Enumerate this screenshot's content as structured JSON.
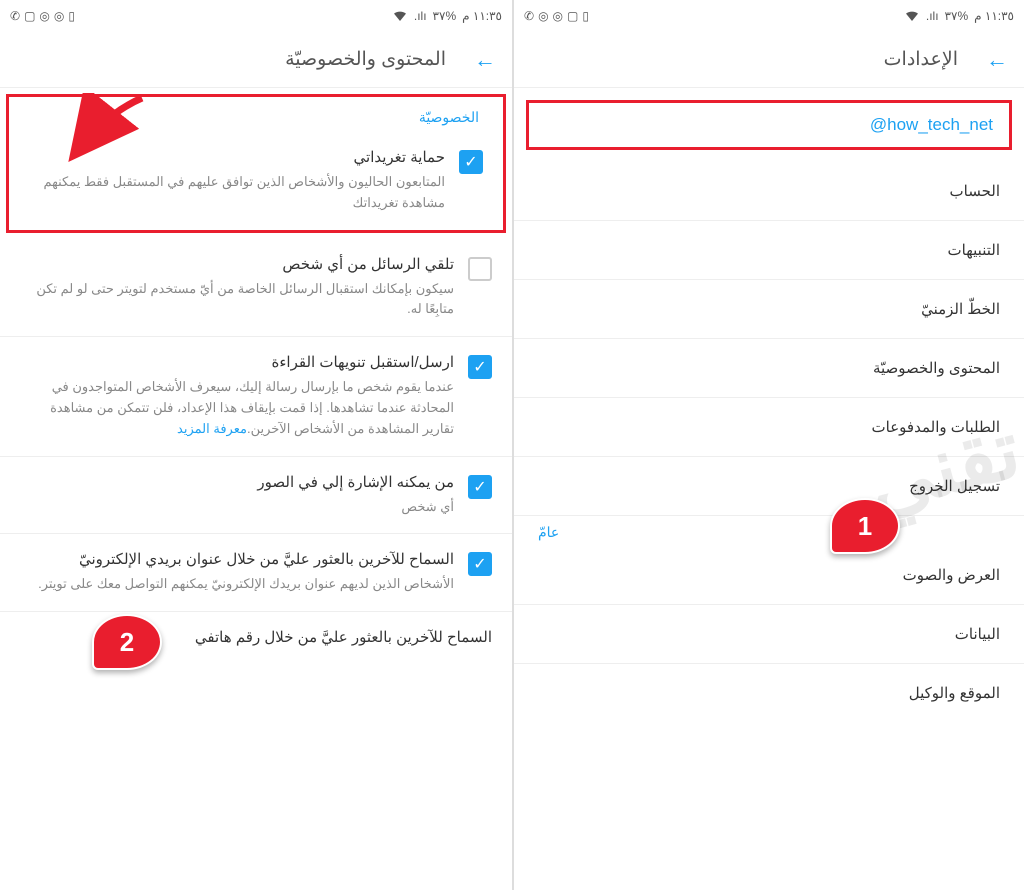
{
  "statusbar": {
    "time": "١١:٣٥ م",
    "battery": "%٣٧"
  },
  "left": {
    "title": "الإعدادات",
    "username": "@how_tech_net",
    "items": [
      "الحساب",
      "التنبيهات",
      "الخطّ الزمنيّ",
      "المحتوى والخصوصيّة",
      "الطلبات والمدفوعات",
      "تسجيل الخروج"
    ],
    "general_label": "عامّ",
    "items2": [
      "العرض والصوت",
      "البيانات",
      "الموقع والوكيل"
    ],
    "badge": "1"
  },
  "right": {
    "title": "المحتوى والخصوصيّة",
    "privacy_label": "الخصوصيّة",
    "protect": {
      "title": "حماية تغريداتي",
      "desc": "المتابعون الحاليون والأشخاص الذين توافق عليهم في المستقبل فقط يمكنهم مشاهدة تغريداتك"
    },
    "dm": {
      "title": "تلقي الرسائل من أي شخص",
      "desc": "سيكون بإمكانك استقبال الرسائل الخاصة من أيّ مستخدم لتويتر حتى لو لم تكن متابِعًا له."
    },
    "receipts": {
      "title": "ارسل/استقبل تنويهات القراءة",
      "desc": "عندما يقوم شخص ما بإرسال رسالة إليك، سيعرف الأشخاص المتواجدون في المحادثة عندما تشاهدها. إذا قمت بإيقاف هذا الإعداد، فلن تتمكن من مشاهدة تقارير المشاهدة من الأشخاص الآخرين.",
      "link": "معرفة المزيد"
    },
    "tagging": {
      "title": "من يمكنه الإشارة إلي في الصور",
      "desc": "أي شخص"
    },
    "email": {
      "title": "السماح للآخرين بالعثور عليَّ من خلال عنوان بريدي الإلكترونيّ",
      "desc": "الأشخاص الذين لديهم عنوان بريدك الإلكترونيّ يمكنهم التواصل معك على تويتر."
    },
    "phone": {
      "title": "السماح للآخرين بالعثور عليَّ من خلال رقم هاتفي"
    },
    "badge": "2"
  },
  "watermark": "كيف تقني"
}
